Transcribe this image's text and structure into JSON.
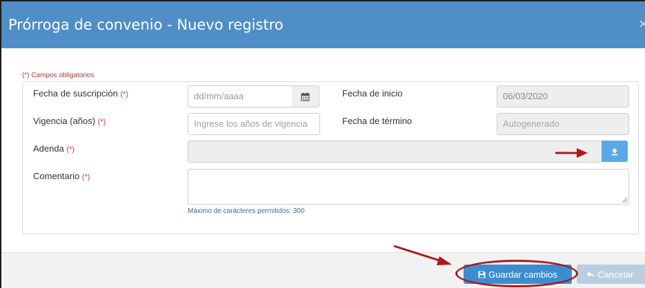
{
  "dialog": {
    "title": "Prórroga de convenio - Nuevo registro",
    "close_glyph": "×",
    "required_note": "(*) Campos obligatorios"
  },
  "form": {
    "fecha_suscripcion": {
      "label": "Fecha de suscripción",
      "marker": "(*)",
      "placeholder": "dd/mm/aaaa",
      "icon": "calendar-icon"
    },
    "vigencia": {
      "label": "Vigencia (años)",
      "marker": "(*)",
      "placeholder": "Ingrese los años de vigencia"
    },
    "fecha_inicio": {
      "label": "Fecha de inicio",
      "value": "06/03/2020"
    },
    "fecha_termino": {
      "label": "Fecha de término",
      "value": "Autogenerado"
    },
    "adenda": {
      "label": "Adenda",
      "marker": "(*)",
      "icon": "upload-icon"
    },
    "comentario": {
      "label": "Comentario",
      "marker": "(*)",
      "hint": "Máximo de carácteres permitidos: 300"
    }
  },
  "footer": {
    "save_label": "Guardar cambios",
    "save_icon": "floppy-disk-icon",
    "cancel_label": "Cancelar",
    "cancel_icon": "reply-arrow-icon"
  },
  "annotations": {
    "color": "#a61c1c"
  },
  "colors": {
    "header": "#4f8ec6",
    "primary_button": "#3c8dcf",
    "upload_button": "#5aa9e6",
    "required": "#c0392b"
  }
}
